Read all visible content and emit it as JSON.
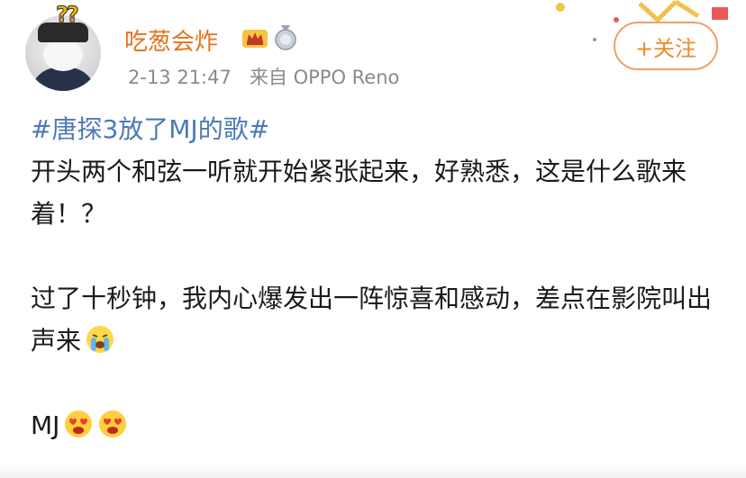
{
  "post": {
    "username": "吃葱会炸",
    "timestamp": "2-13 21:47",
    "source": "来自 OPPO Reno",
    "follow_label": "+关注",
    "topic": "#唐探3放了MJ的歌#",
    "line1": "开头两个和弦一听就开始紧张起来，好熟悉，这是什么歌来着！？",
    "line2": "过了十秒钟，我内心爆发出一阵惊喜和感动，差点在影院叫出声来",
    "line3": "MJ",
    "accent_color": "#e8711c",
    "topic_color": "#4d79b6",
    "icons": [
      "crown-badge-icon",
      "medal-badge-icon",
      "crying-emoji-icon",
      "heart-eyes-emoji-icon"
    ]
  }
}
